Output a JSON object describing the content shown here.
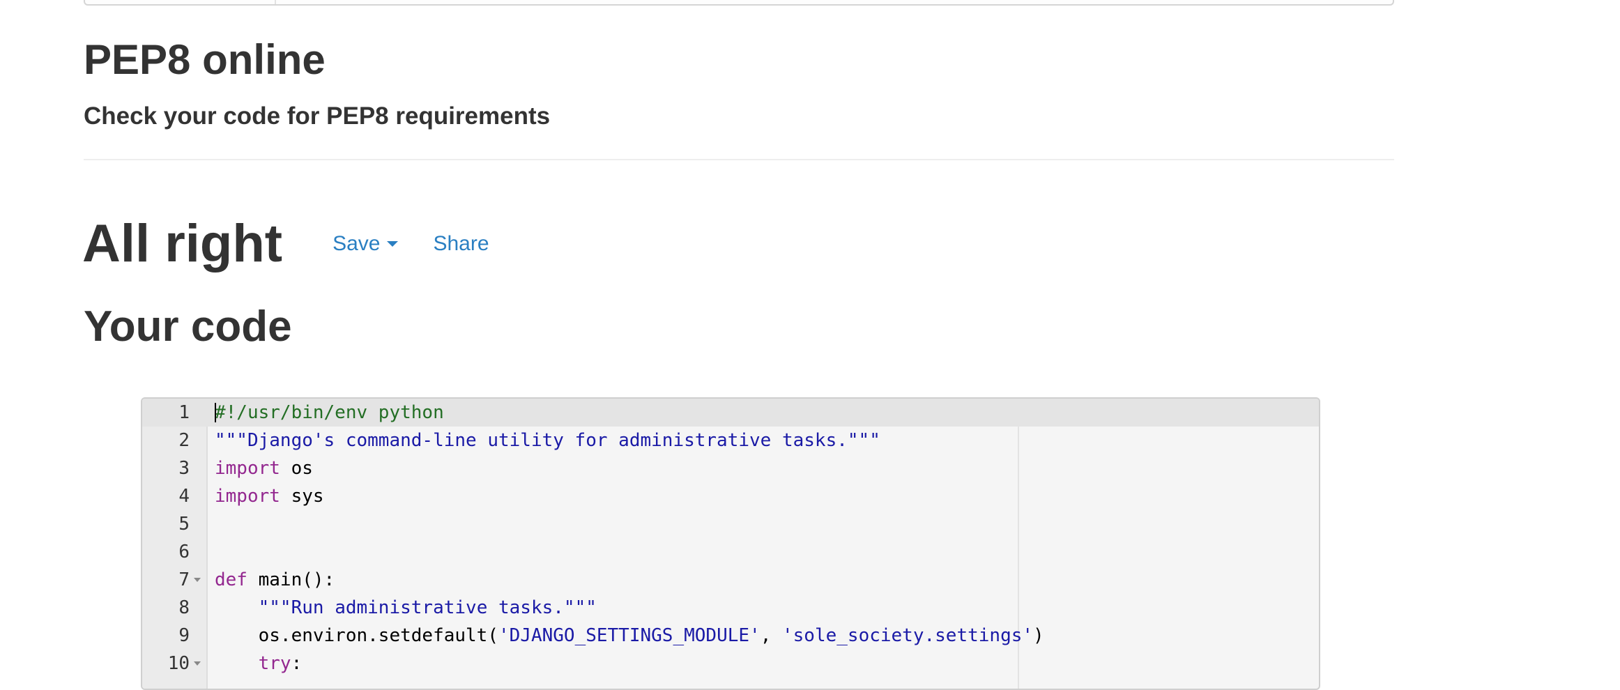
{
  "header": {
    "title": "PEP8 online",
    "subtitle": "Check your code for PEP8 requirements"
  },
  "result": {
    "title": "All right",
    "save_label": "Save",
    "share_label": "Share"
  },
  "code_section": {
    "title": "Your code"
  },
  "editor": {
    "lines": [
      {
        "n": "1",
        "fold": false,
        "tokens": [
          {
            "t": "comment",
            "v": "#!/usr/bin/env python"
          }
        ]
      },
      {
        "n": "2",
        "fold": false,
        "tokens": [
          {
            "t": "string",
            "v": "\"\"\"Django's command-line utility for administrative tasks.\"\"\""
          }
        ]
      },
      {
        "n": "3",
        "fold": false,
        "tokens": [
          {
            "t": "keyword",
            "v": "import"
          },
          {
            "t": "plain",
            "v": " os"
          }
        ]
      },
      {
        "n": "4",
        "fold": false,
        "tokens": [
          {
            "t": "keyword",
            "v": "import"
          },
          {
            "t": "plain",
            "v": " sys"
          }
        ]
      },
      {
        "n": "5",
        "fold": false,
        "tokens": []
      },
      {
        "n": "6",
        "fold": false,
        "tokens": []
      },
      {
        "n": "7",
        "fold": true,
        "tokens": [
          {
            "t": "keyword",
            "v": "def"
          },
          {
            "t": "plain",
            "v": " main():"
          }
        ]
      },
      {
        "n": "8",
        "fold": false,
        "tokens": [
          {
            "t": "plain",
            "v": "    "
          },
          {
            "t": "string",
            "v": "\"\"\"Run administrative tasks.\"\"\""
          }
        ]
      },
      {
        "n": "9",
        "fold": false,
        "tokens": [
          {
            "t": "plain",
            "v": "    os.environ.setdefault("
          },
          {
            "t": "string",
            "v": "'DJANGO_SETTINGS_MODULE'"
          },
          {
            "t": "plain",
            "v": ", "
          },
          {
            "t": "string",
            "v": "'sole_society.settings'"
          },
          {
            "t": "plain",
            "v": ")"
          }
        ]
      },
      {
        "n": "10",
        "fold": true,
        "tokens": [
          {
            "t": "plain",
            "v": "    "
          },
          {
            "t": "keyword",
            "v": "try"
          },
          {
            "t": "plain",
            "v": ":"
          }
        ]
      }
    ]
  }
}
